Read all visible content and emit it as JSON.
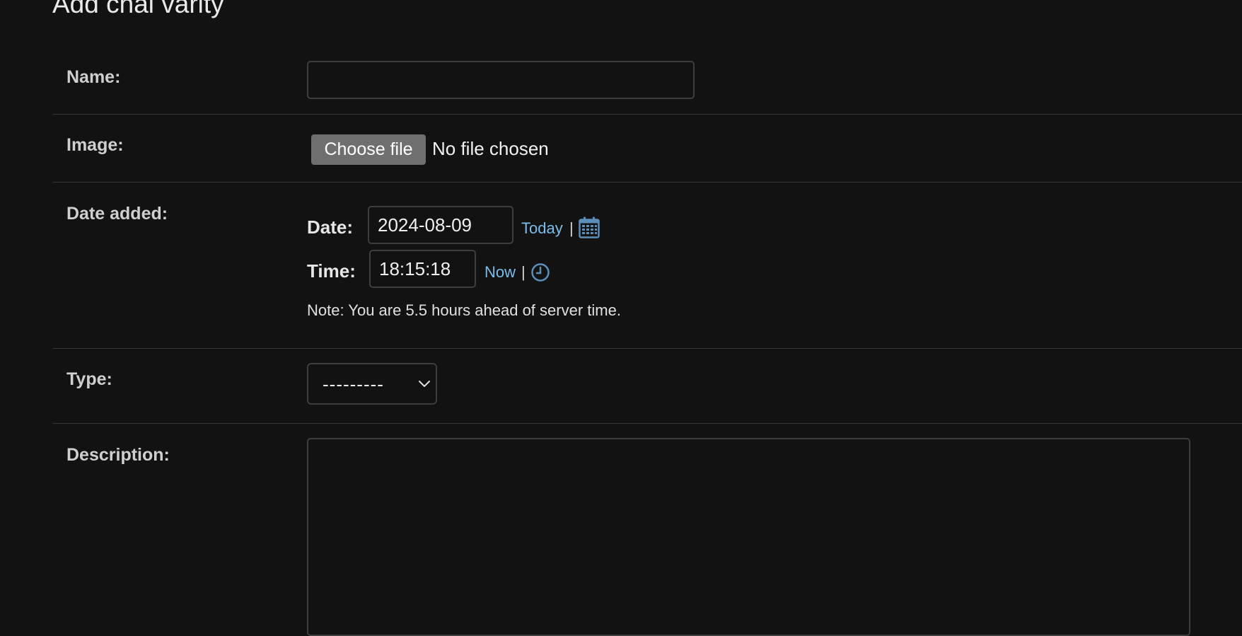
{
  "page": {
    "title": "Add chai varity"
  },
  "fields": {
    "name": {
      "label": "Name:",
      "value": ""
    },
    "image": {
      "label": "Image:",
      "button_label": "Choose file",
      "status": "No file chosen"
    },
    "date_added": {
      "label": "Date added:",
      "date_label": "Date:",
      "date_value": "2024-08-09",
      "today_link": "Today",
      "separator": "|",
      "calendar_icon": "calendar-icon",
      "time_label": "Time:",
      "time_value": "18:15:18",
      "now_link": "Now",
      "clock_icon": "clock-icon",
      "help_text": "Note: You are 5.5 hours ahead of server time."
    },
    "type": {
      "label": "Type:",
      "selected": "---------",
      "chevron_icon": "chevron-down-icon"
    },
    "description": {
      "label": "Description:",
      "value": ""
    }
  },
  "colors": {
    "background": "#121212",
    "link": "#79bde8",
    "icon": "#5b8fb9",
    "border": "#3d3d3d",
    "row_divider": "#353535"
  }
}
